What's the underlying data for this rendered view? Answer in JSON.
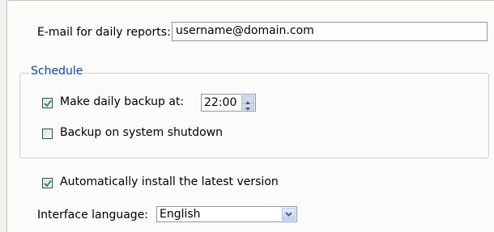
{
  "email": {
    "label": "E-mail for daily reports:",
    "value": "username@domain.com"
  },
  "schedule": {
    "title": "Schedule",
    "daily_backup": {
      "label": "Make daily backup at:",
      "checked": true,
      "time": "22:00"
    },
    "shutdown_backup": {
      "label": "Backup on system shutdown",
      "checked": false
    }
  },
  "auto_update": {
    "label": "Automatically install the latest version",
    "checked": true
  },
  "language": {
    "label": "Interface language:",
    "value": "English"
  },
  "colors": {
    "group_title": "#0046d5",
    "check_mark": "#21a121",
    "checkbox_border": "#1c5180"
  },
  "icons": {
    "checkmark": "checkmark-icon",
    "spin_up": "spin-up-arrow-icon",
    "spin_down": "spin-down-arrow-icon",
    "dropdown": "chevron-down-icon"
  }
}
